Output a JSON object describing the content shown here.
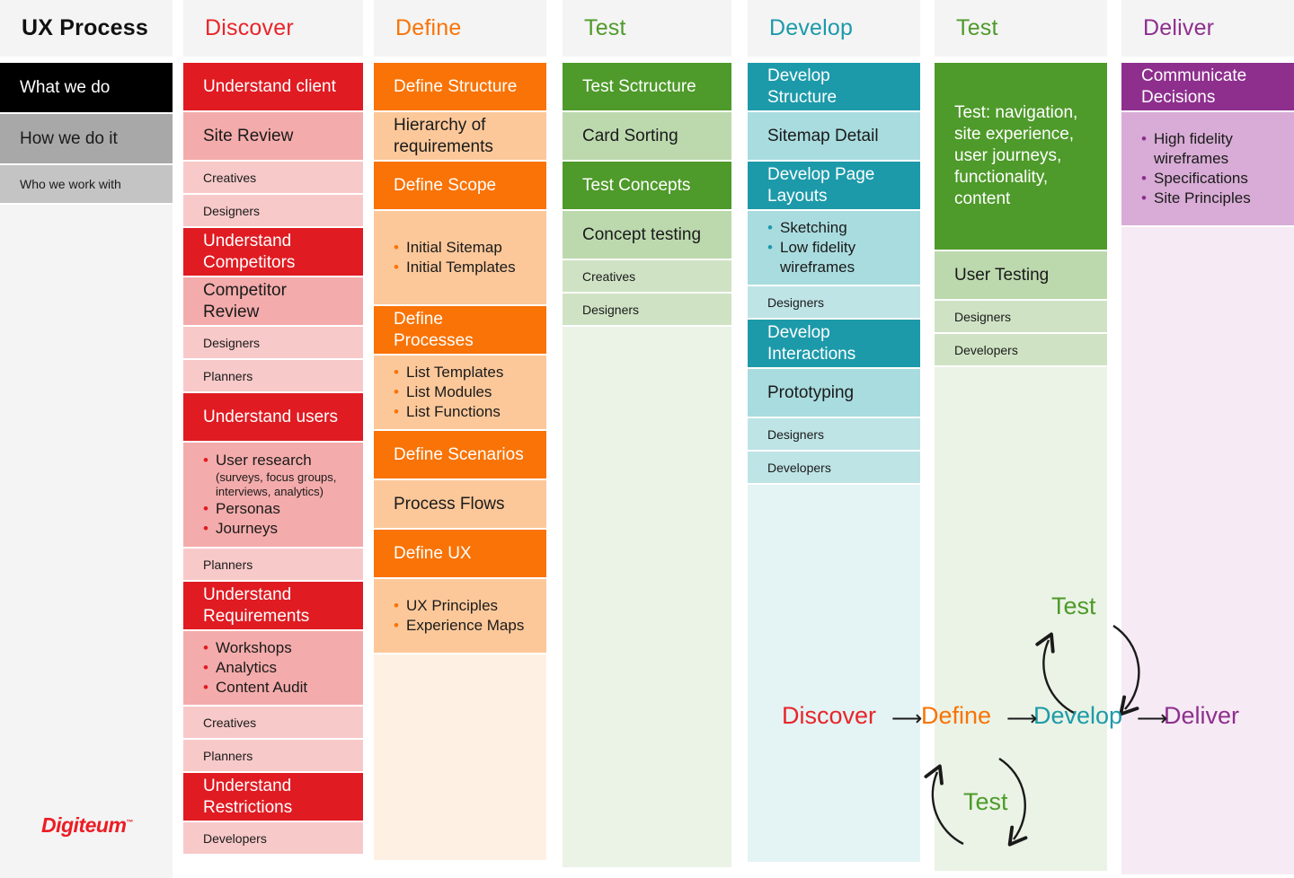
{
  "header": {
    "title": "UX Process",
    "stages": [
      {
        "label": "Discover",
        "color": "#E8252A"
      },
      {
        "label": "Define",
        "color": "#F97306"
      },
      {
        "label": "Test",
        "color": "#4E9A2A"
      },
      {
        "label": "Develop",
        "color": "#1C9AAA"
      },
      {
        "label": "Test",
        "color": "#4E9A2A"
      },
      {
        "label": "Deliver",
        "color": "#8E2F8E"
      }
    ]
  },
  "sidebar": {
    "items": [
      {
        "label": "What we do",
        "bg": "#000000",
        "fg": "#ffffff",
        "size": "mid"
      },
      {
        "label": "How we do it",
        "bg": "#A8A8A8",
        "fg": "#1a1a1a",
        "size": "mid"
      },
      {
        "label": "Who we work with",
        "bg": "#C4C4C4",
        "fg": "#1a1a1a",
        "size": "small"
      }
    ],
    "filler_bg": "#F4F4F4"
  },
  "columns": [
    {
      "name": "discover",
      "accent": "#E01B22",
      "tone_mid": "#F4ABAB",
      "tone_light": "#F8C9C9",
      "filler": "#FCEDED",
      "bullet": "#E01B22",
      "rows": [
        {
          "type": "head",
          "text": "Understand client"
        },
        {
          "type": "mid",
          "text": "Site Review"
        },
        {
          "type": "role",
          "text": "Creatives"
        },
        {
          "type": "role",
          "text": "Designers"
        },
        {
          "type": "head",
          "text": "Understand Competitors"
        },
        {
          "type": "mid",
          "text": "Competitor Review"
        },
        {
          "type": "role",
          "text": "Designers"
        },
        {
          "type": "role",
          "text": "Planners"
        },
        {
          "type": "head",
          "text": "Understand users"
        },
        {
          "type": "list",
          "items": [
            "User research",
            "Personas",
            "Journeys"
          ],
          "note_after": 0,
          "note": "(surveys, focus groups, interviews, analytics)"
        },
        {
          "type": "role",
          "text": "Planners"
        },
        {
          "type": "head",
          "text": "Understand Requirements"
        },
        {
          "type": "list",
          "items": [
            "Workshops",
            "Analytics",
            "Content Audit"
          ]
        },
        {
          "type": "role",
          "text": "Creatives"
        },
        {
          "type": "role",
          "text": "Planners"
        },
        {
          "type": "head",
          "text": "Understand Restrictions"
        },
        {
          "type": "role",
          "text": "Developers"
        }
      ]
    },
    {
      "name": "define",
      "accent": "#F97306",
      "tone_mid": "#FCC89A",
      "tone_light": "#FDD9B6",
      "filler": "#FEF1E4",
      "bullet": "#F97306",
      "rows": [
        {
          "type": "head",
          "text": "Define Structure"
        },
        {
          "type": "mid",
          "text": "Hierarchy of requirements"
        },
        {
          "type": "head",
          "text": "Define Scope"
        },
        {
          "type": "list",
          "items": [
            "Initial Sitemap",
            "Initial Templates"
          ]
        },
        {
          "type": "head",
          "text": "Define Processes"
        },
        {
          "type": "list",
          "items": [
            "List Templates",
            "List Modules",
            "List Functions"
          ]
        },
        {
          "type": "head",
          "text": "Define Scenarios"
        },
        {
          "type": "mid",
          "text": "Process Flows"
        },
        {
          "type": "head",
          "text": "Define UX"
        },
        {
          "type": "list",
          "items": [
            "UX Principles",
            "Experience Maps"
          ]
        }
      ]
    },
    {
      "name": "test-1",
      "accent": "#4E9A2A",
      "tone_mid": "#BCD9AE",
      "tone_light": "#CFE3C4",
      "filler": "#EAF3E5",
      "bullet": "#4E9A2A",
      "rows": [
        {
          "type": "head",
          "text": "Test Sctructure"
        },
        {
          "type": "mid",
          "text": "Card Sorting"
        },
        {
          "type": "head",
          "text": "Test Concepts"
        },
        {
          "type": "mid",
          "text": "Concept testing"
        },
        {
          "type": "role",
          "text": "Creatives"
        },
        {
          "type": "role",
          "text": "Designers"
        }
      ]
    },
    {
      "name": "develop",
      "accent": "#1C9AAA",
      "tone_mid": "#A9DCDF",
      "tone_light": "#BEE4E6",
      "filler": "#E4F3F4",
      "bullet": "#1C9AAA",
      "rows": [
        {
          "type": "head",
          "text": "Develop Structure"
        },
        {
          "type": "mid",
          "text": "Sitemap Detail"
        },
        {
          "type": "head",
          "text": "Develop Page Layouts"
        },
        {
          "type": "list",
          "items": [
            "Sketching",
            "Low fidelity wireframes"
          ]
        },
        {
          "type": "role",
          "text": "Designers"
        },
        {
          "type": "head",
          "text": "Develop Interactions"
        },
        {
          "type": "mid",
          "text": "Prototyping"
        },
        {
          "type": "role",
          "text": "Designers"
        },
        {
          "type": "role",
          "text": "Developers"
        }
      ]
    },
    {
      "name": "test-2",
      "accent": "#4E9A2A",
      "tone_mid": "#BCD9AE",
      "tone_light": "#CFE3C4",
      "filler": "#EAF3E5",
      "bullet": "#4E9A2A",
      "rows": [
        {
          "type": "head",
          "text": "Test: navigation, site experience, user journeys, functionality, content"
        },
        {
          "type": "mid",
          "text": "User Testing"
        },
        {
          "type": "role",
          "text": "Designers"
        },
        {
          "type": "role",
          "text": "Developers"
        }
      ]
    },
    {
      "name": "deliver",
      "accent": "#8E2F8E",
      "tone_mid": "#D8ACD6",
      "tone_light": "#E3C2E1",
      "filler": "#F6EAF5",
      "bullet": "#8E2F8E",
      "rows": [
        {
          "type": "head",
          "text": "Communicate Decisions"
        },
        {
          "type": "list",
          "items": [
            "High fidelity wireframes",
            "Specifications",
            "Site Principles"
          ]
        }
      ]
    }
  ],
  "logo": {
    "text": "Digiteum",
    "tm": "™",
    "color": "#ED1C24"
  },
  "cycle": {
    "flow": [
      {
        "label": "Discover",
        "color": "#E8252A"
      },
      {
        "label": "Define",
        "color": "#F97306"
      },
      {
        "label": "Develop",
        "color": "#1C9AAA"
      },
      {
        "label": "Deliver",
        "color": "#8E2F8E"
      }
    ],
    "arrow_glyph": "⟶",
    "loop_top": {
      "label": "Test",
      "color": "#4E9A2A"
    },
    "loop_bottom": {
      "label": "Test",
      "color": "#4E9A2A"
    }
  }
}
